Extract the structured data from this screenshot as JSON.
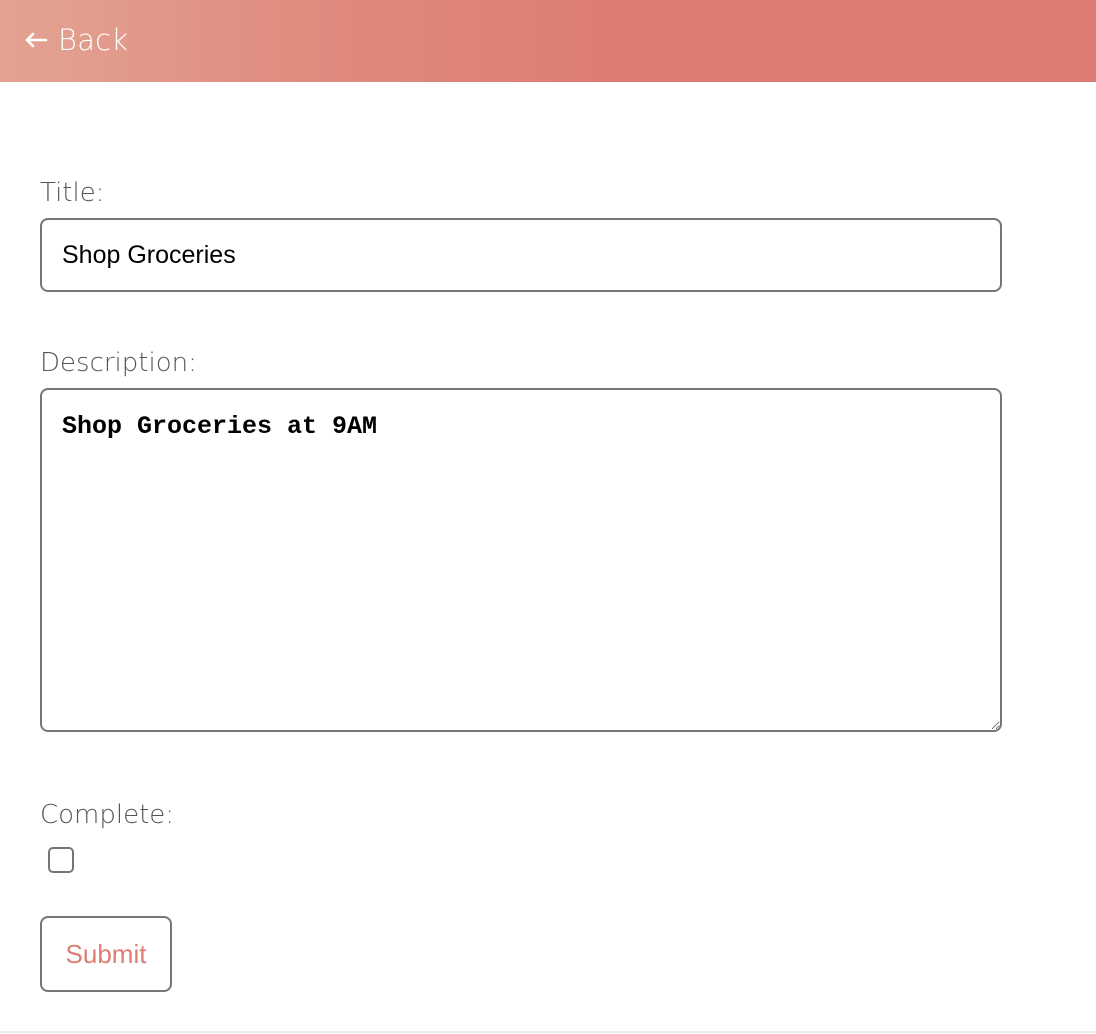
{
  "header": {
    "back_label": "Back",
    "back_icon": "arrow-left-icon",
    "gradient_start": "#e3a392",
    "gradient_end": "#dc7c72"
  },
  "form": {
    "title_label": "Title:",
    "title_value": "Shop Groceries",
    "description_label": "Description:",
    "description_value": "Shop Groceries at 9AM",
    "complete_label": "Complete:",
    "complete_checked": false,
    "submit_label": "Submit"
  },
  "colors": {
    "accent": "#dc7c72",
    "label_text": "#555555",
    "border": "#767676"
  }
}
